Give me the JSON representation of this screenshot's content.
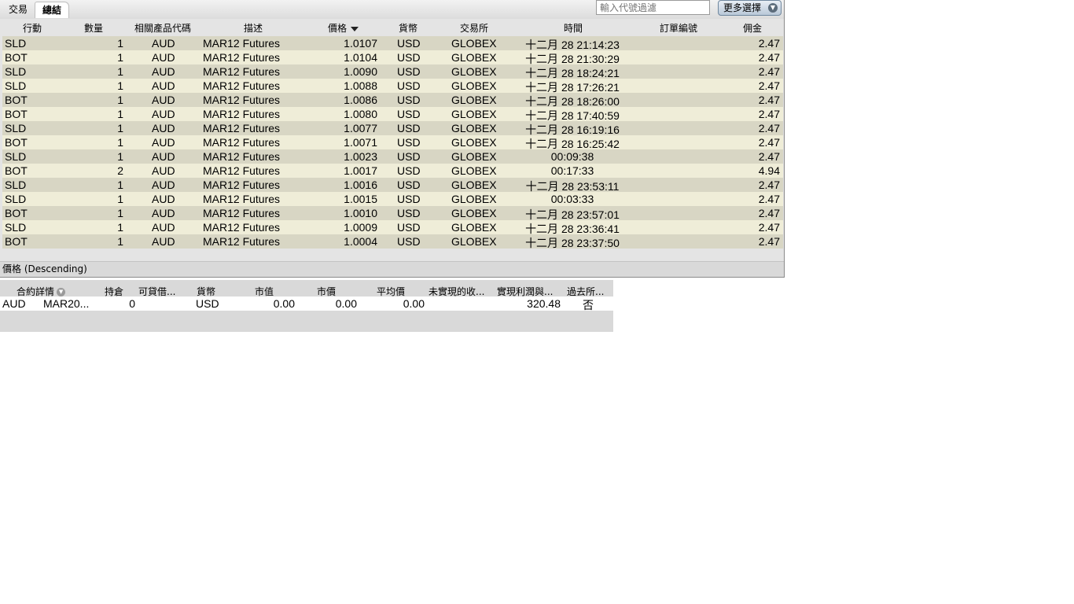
{
  "tabs": {
    "trades": "交易",
    "summary": "總結"
  },
  "filter": {
    "placeholder": "輸入代號過濾"
  },
  "more_button": {
    "label": "更多選擇"
  },
  "trades_table": {
    "columns": {
      "action": "行動",
      "qty": "數量",
      "symbol": "相關產品代碼",
      "desc": "描述",
      "price": "價格",
      "currency": "貨幣",
      "exchange": "交易所",
      "time": "時間",
      "order_ref": "訂單編號",
      "commission": "佣金"
    },
    "rows": [
      {
        "action": "SLD",
        "qty": "1",
        "symbol": "AUD",
        "desc": "MAR12 Futures",
        "price": "1.0107",
        "currency": "USD",
        "exchange": "GLOBEX",
        "time": "十二月 28 21:14:23",
        "commission": "2.47"
      },
      {
        "action": "BOT",
        "qty": "1",
        "symbol": "AUD",
        "desc": "MAR12 Futures",
        "price": "1.0104",
        "currency": "USD",
        "exchange": "GLOBEX",
        "time": "十二月 28 21:30:29",
        "commission": "2.47"
      },
      {
        "action": "SLD",
        "qty": "1",
        "symbol": "AUD",
        "desc": "MAR12 Futures",
        "price": "1.0090",
        "currency": "USD",
        "exchange": "GLOBEX",
        "time": "十二月 28 18:24:21",
        "commission": "2.47"
      },
      {
        "action": "SLD",
        "qty": "1",
        "symbol": "AUD",
        "desc": "MAR12 Futures",
        "price": "1.0088",
        "currency": "USD",
        "exchange": "GLOBEX",
        "time": "十二月 28 17:26:21",
        "commission": "2.47"
      },
      {
        "action": "BOT",
        "qty": "1",
        "symbol": "AUD",
        "desc": "MAR12 Futures",
        "price": "1.0086",
        "currency": "USD",
        "exchange": "GLOBEX",
        "time": "十二月 28 18:26:00",
        "commission": "2.47"
      },
      {
        "action": "BOT",
        "qty": "1",
        "symbol": "AUD",
        "desc": "MAR12 Futures",
        "price": "1.0080",
        "currency": "USD",
        "exchange": "GLOBEX",
        "time": "十二月 28 17:40:59",
        "commission": "2.47"
      },
      {
        "action": "SLD",
        "qty": "1",
        "symbol": "AUD",
        "desc": "MAR12 Futures",
        "price": "1.0077",
        "currency": "USD",
        "exchange": "GLOBEX",
        "time": "十二月 28 16:19:16",
        "commission": "2.47"
      },
      {
        "action": "BOT",
        "qty": "1",
        "symbol": "AUD",
        "desc": "MAR12 Futures",
        "price": "1.0071",
        "currency": "USD",
        "exchange": "GLOBEX",
        "time": "十二月 28 16:25:42",
        "commission": "2.47"
      },
      {
        "action": "SLD",
        "qty": "1",
        "symbol": "AUD",
        "desc": "MAR12 Futures",
        "price": "1.0023",
        "currency": "USD",
        "exchange": "GLOBEX",
        "time": "00:09:38",
        "commission": "2.47"
      },
      {
        "action": "BOT",
        "qty": "2",
        "symbol": "AUD",
        "desc": "MAR12 Futures",
        "price": "1.0017",
        "currency": "USD",
        "exchange": "GLOBEX",
        "time": "00:17:33",
        "commission": "4.94"
      },
      {
        "action": "SLD",
        "qty": "1",
        "symbol": "AUD",
        "desc": "MAR12 Futures",
        "price": "1.0016",
        "currency": "USD",
        "exchange": "GLOBEX",
        "time": "十二月 28 23:53:11",
        "commission": "2.47"
      },
      {
        "action": "SLD",
        "qty": "1",
        "symbol": "AUD",
        "desc": "MAR12 Futures",
        "price": "1.0015",
        "currency": "USD",
        "exchange": "GLOBEX",
        "time": "00:03:33",
        "commission": "2.47"
      },
      {
        "action": "BOT",
        "qty": "1",
        "symbol": "AUD",
        "desc": "MAR12 Futures",
        "price": "1.0010",
        "currency": "USD",
        "exchange": "GLOBEX",
        "time": "十二月 28 23:57:01",
        "commission": "2.47"
      },
      {
        "action": "SLD",
        "qty": "1",
        "symbol": "AUD",
        "desc": "MAR12 Futures",
        "price": "1.0009",
        "currency": "USD",
        "exchange": "GLOBEX",
        "time": "十二月 28 23:36:41",
        "commission": "2.47"
      },
      {
        "action": "BOT",
        "qty": "1",
        "symbol": "AUD",
        "desc": "MAR12 Futures",
        "price": "1.0004",
        "currency": "USD",
        "exchange": "GLOBEX",
        "time": "十二月 28 23:37:50",
        "commission": "2.47"
      }
    ]
  },
  "status_bar": {
    "sort_text": "價格 (Descending)"
  },
  "portfolio": {
    "columns": {
      "contract": "合約詳情",
      "position": "持倉",
      "borrowable": "可貸借...",
      "currency": "貨幣",
      "market_value": "市值",
      "market_price": "市價",
      "avg_price": "平均價",
      "unrealized": "未實現的收...",
      "realized": "實現利潤與...",
      "past": "過去所..."
    },
    "row": {
      "symbol": "AUD",
      "contract": "MAR20...",
      "position": "0",
      "currency": "USD",
      "market_value": "0.00",
      "market_price": "0.00",
      "avg_price": "0.00",
      "realized": "320.48",
      "past": "否"
    }
  },
  "colors": {
    "row_odd": "#d8d6c4",
    "row_even": "#efedd8",
    "panel": "#e4e4e4"
  },
  "icons": {
    "more": "chevron-down-icon",
    "sort": "sort-descending-icon",
    "info": "info-icon"
  }
}
